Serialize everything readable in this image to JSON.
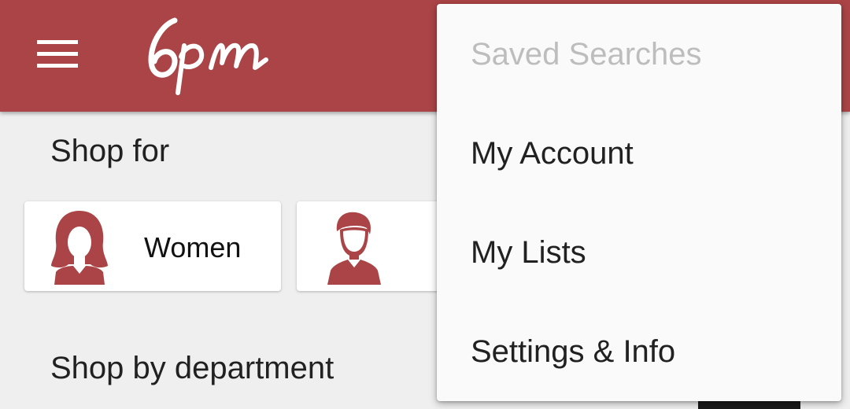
{
  "app_bar": {
    "logo_text": "6pm",
    "menu_icon": "hamburger-menu-icon",
    "color": "#ab4446"
  },
  "shop_for": {
    "title": "Shop for",
    "cards": [
      {
        "label": "Women",
        "icon": "woman-avatar-icon"
      },
      {
        "label": "",
        "icon": "man-avatar-icon"
      }
    ]
  },
  "department": {
    "title": "Shop by department"
  },
  "overflow_menu": {
    "items": [
      {
        "label": "Saved Searches",
        "enabled": false
      },
      {
        "label": "My Account",
        "enabled": true
      },
      {
        "label": "My Lists",
        "enabled": true
      },
      {
        "label": "Settings & Info",
        "enabled": true
      }
    ]
  }
}
